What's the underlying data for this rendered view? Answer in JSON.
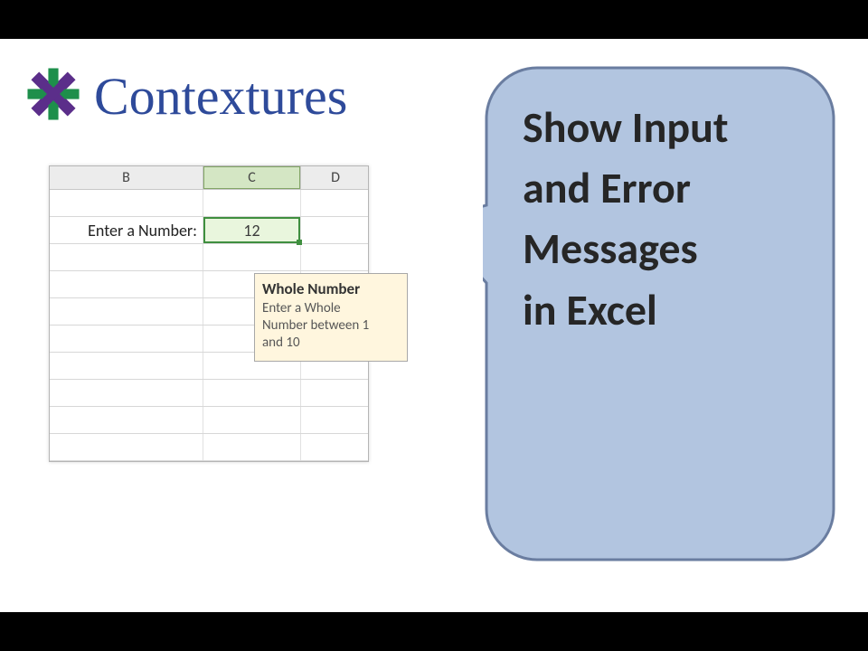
{
  "brand": {
    "name": "Contextures"
  },
  "sheet": {
    "colB": "B",
    "colC": "C",
    "colD": "D",
    "promptLabel": "Enter a Number:",
    "selectedValue": "12"
  },
  "tooltip": {
    "title": "Whole Number",
    "line1": "Enter a Whole",
    "line2": "Number between 1",
    "line3": "and 10"
  },
  "callout": {
    "line1": "Show Input",
    "line2": "and Error",
    "line3": "Messages",
    "line4": " in Excel"
  },
  "colors": {
    "brandText": "#2e4a9a",
    "logoGreen": "#1e8f4b",
    "logoPurple": "#5b2e8a",
    "calloutFill": "#b2c5e0",
    "calloutStroke": "#6a7da0",
    "tooltipBg": "#fff6de",
    "cellSelect": "#3f8f3f"
  }
}
